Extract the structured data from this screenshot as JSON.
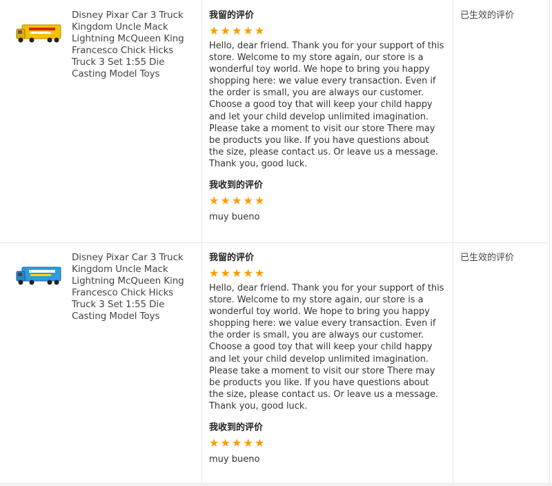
{
  "orders": [
    {
      "product_title": "Disney Pixar Car 3 Truck Kingdom Uncle Mack Lightning McQueen King Francesco Chick Hicks Truck 3 Set 1:55 Die Casting Model Toys",
      "truck_color": "#f2c200",
      "my_review": {
        "heading": "我留的评价",
        "stars": 5,
        "text": "Hello, dear friend. Thank you for your support of this store. Welcome to my store again, our store is a wonderful toy world. We hope to bring you happy shopping here: we value every transaction. Even if the order is small, you are always our customer. Choose a good toy that will keep your child happy and let your child develop unlimited imagination. Please take a moment to visit our store There may be products you like. If you have questions about the size, please contact us. Or leave us a message. Thank you, good luck."
      },
      "received_review": {
        "heading": "我收到的评价",
        "stars": 5,
        "text": "muy bueno"
      },
      "status": "已生效的评价"
    },
    {
      "product_title": "Disney Pixar Car 3 Truck Kingdom Uncle Mack Lightning McQueen King Francesco Chick Hicks Truck 3 Set 1:55 Die Casting Model Toys",
      "truck_color": "#2f9be0",
      "my_review": {
        "heading": "我留的评价",
        "stars": 5,
        "text": "Hello, dear friend. Thank you for your support of this store. Welcome to my store again, our store is a wonderful toy world. We hope to bring you happy shopping here: we value every transaction. Even if the order is small, you are always our customer. Choose a good toy that will keep your child happy and let your child develop unlimited imagination. Please take a moment to visit our store There may be products you like. If you have questions about the size, please contact us. Or leave us a message. Thank you, good luck."
      },
      "received_review": {
        "heading": "我收到的评价",
        "stars": 5,
        "text": "muy bueno"
      },
      "status": "已生效的评价"
    }
  ],
  "colors": {
    "star": "#ff9a00",
    "border": "#e8e8e8",
    "text": "#333333"
  }
}
